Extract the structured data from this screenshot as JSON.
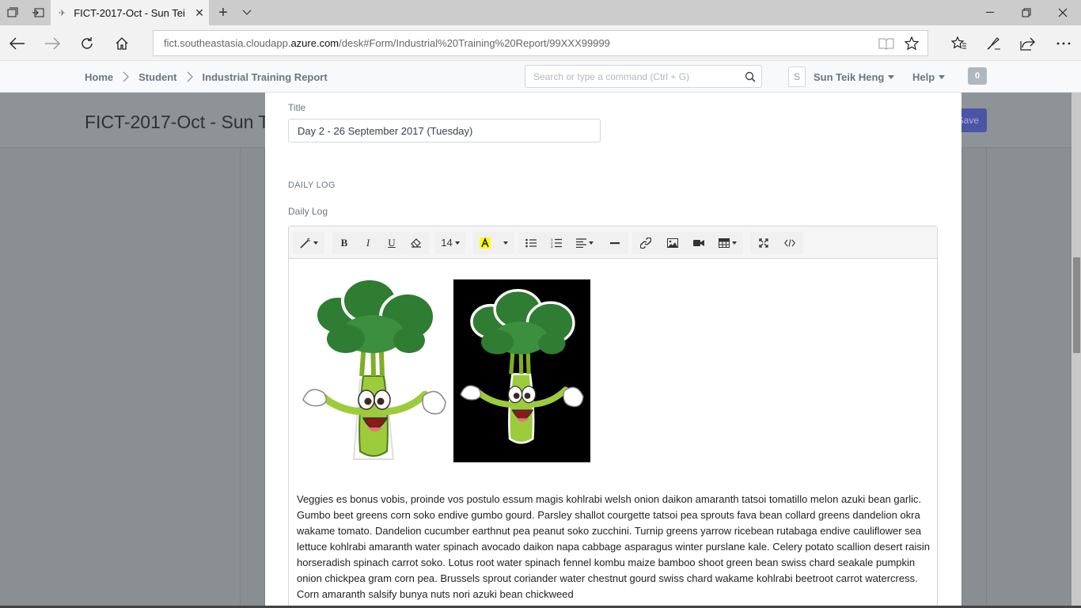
{
  "browser": {
    "tab_title": "FICT-2017-Oct - Sun Tei",
    "url_prefix": "fict.southeastasia.cloudapp.",
    "url_domain": "azure.com",
    "url_path": "/desk#Form/Industrial%20Training%20Report/99XXX99999"
  },
  "header": {
    "breadcrumbs": [
      "Home",
      "Student",
      "Industrial Training Report"
    ],
    "search_placeholder": "Search or type a command (Ctrl + G)",
    "avatar_initial": "S",
    "user_name": "Sun Teik Heng",
    "help_label": "Help",
    "notification_count": "0"
  },
  "page": {
    "title": "FICT-2017-Oct - Sun T",
    "save_label": "Save"
  },
  "dialog": {
    "title_label": "Title",
    "title_value": "Day 2 - 26 September 2017 (Tuesday)",
    "section_heading": "DAILY LOG",
    "daily_log_label": "Daily Log",
    "font_size": "14",
    "paragraph": "Veggies es bonus vobis, proinde vos postulo essum magis kohlrabi welsh onion daikon amaranth tatsoi tomatillo melon azuki bean garlic. Gumbo beet greens corn soko endive gumbo gourd. Parsley shallot courgette tatsoi pea sprouts fava bean collard greens dandelion okra wakame tomato. Dandelion cucumber earthnut pea peanut soko zucchini. Turnip greens yarrow ricebean rutabaga endive cauliflower sea lettuce kohlrabi amaranth water spinach avocado daikon napa cabbage asparagus winter purslane kale. Celery potato scallion desert raisin horseradish spinach carrot soko. Lotus root water spinach fennel kombu maize bamboo shoot green bean swiss chard seakale pumpkin onion chickpea gram corn pea. Brussels sprout coriander water chestnut gourd swiss chard wakame kohlrabi beetroot carrot watercress. Corn amaranth salsify bunya nuts nori azuki bean chickweed"
  },
  "colors": {
    "accent": "#4b55a5",
    "highlight": "#ffff00",
    "broccoli_dark": "#2e7d32",
    "broccoli_stem": "#9ccc3c"
  }
}
